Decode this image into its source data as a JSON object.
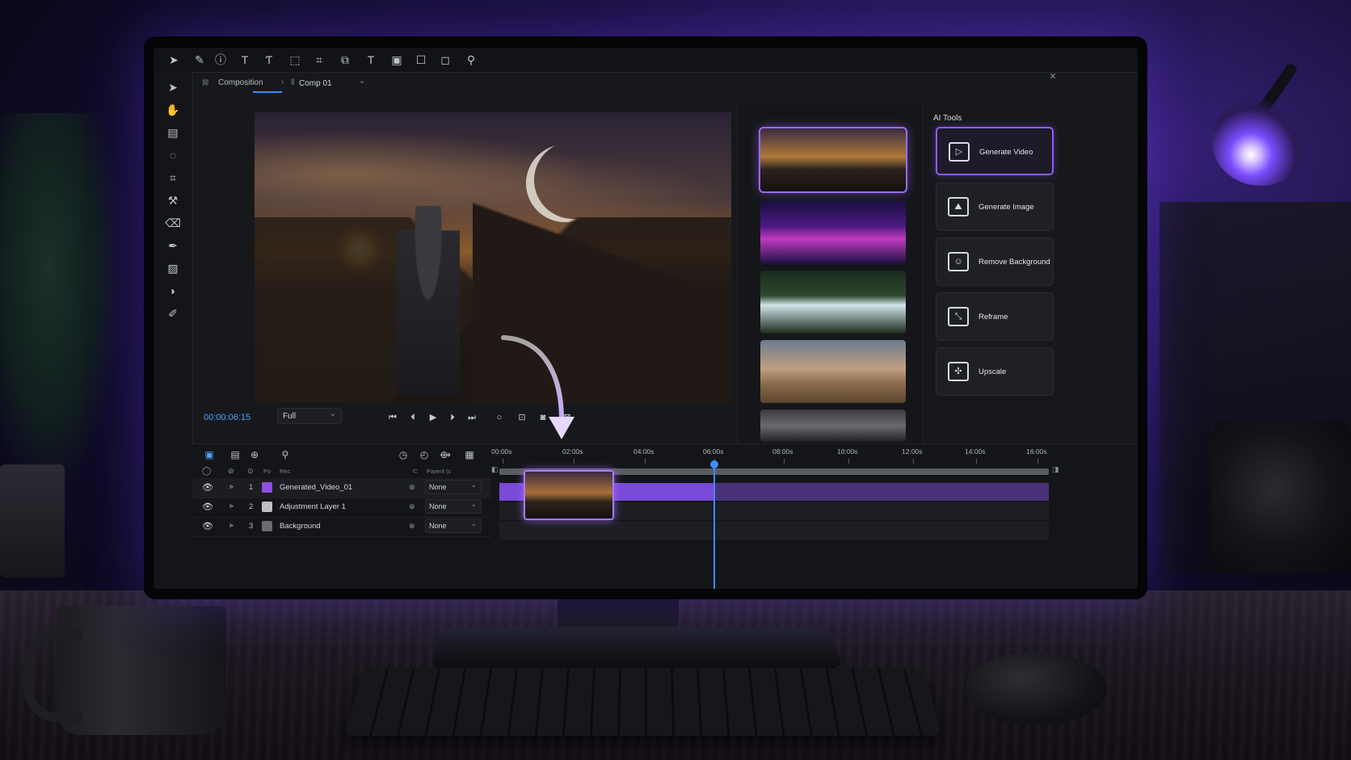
{
  "breadcrumb": {
    "root": "Composition",
    "current": "Comp 01"
  },
  "transport": {
    "timecode": "00:00:06:15",
    "quality": "Full"
  },
  "ai_tools": {
    "title": "AI Tools",
    "items": [
      {
        "label": "Generate Video",
        "icon": "video-play-icon",
        "selected": true
      },
      {
        "label": "Generate Image",
        "icon": "image-icon",
        "selected": false
      },
      {
        "label": "Remove Background",
        "icon": "person-cutout-icon",
        "selected": false
      },
      {
        "label": "Reframe",
        "icon": "reframe-icon",
        "selected": false
      },
      {
        "label": "Upscale",
        "icon": "upscale-icon",
        "selected": false
      }
    ]
  },
  "timeline": {
    "ruler": [
      "00:00s",
      "02:00s",
      "04:00s",
      "06:00s",
      "08:00s",
      "10:00s",
      "12:00s",
      "14:00s",
      "16:00s"
    ],
    "header": {
      "name_col": "Rec",
      "parent_col": "Parent (c",
      "pos_col": "Po"
    },
    "layers": [
      {
        "index": "1",
        "name": "Generated_Video_01",
        "parent": "None",
        "swatch": "#8e4fe0"
      },
      {
        "index": "2",
        "name": "Adjustment Layer 1",
        "parent": "None",
        "swatch": "#bdbdc2"
      },
      {
        "index": "3",
        "name": "Background",
        "parent": "None",
        "swatch": "#6a6a70"
      }
    ]
  },
  "colors": {
    "accent": "#8e5cff",
    "timecode": "#4fa3ff",
    "playhead": "#3b8cff"
  }
}
